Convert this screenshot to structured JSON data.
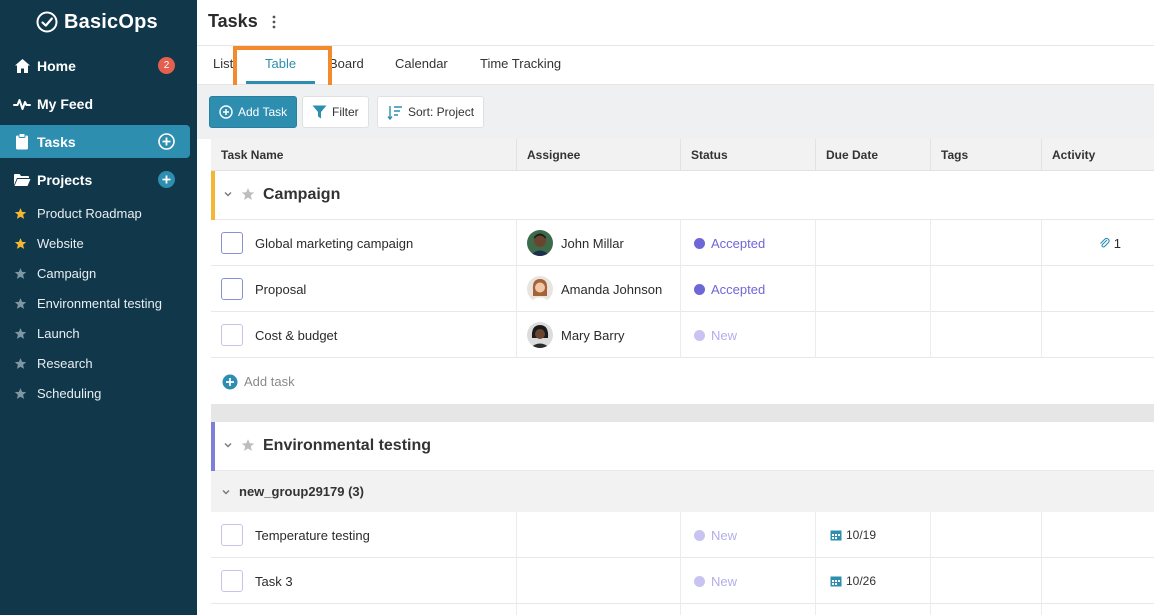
{
  "brand": {
    "name": "BasicOps"
  },
  "sidebar": {
    "nav": [
      {
        "label": "Home",
        "icon": "home-icon",
        "badge": "2"
      },
      {
        "label": "My Feed",
        "icon": "pulse-icon"
      },
      {
        "label": "Tasks",
        "icon": "clipboard-icon",
        "active": true
      },
      {
        "label": "Projects",
        "icon": "folder-icon"
      }
    ],
    "projects": [
      {
        "label": "Product Roadmap",
        "starred": true
      },
      {
        "label": "Website",
        "starred": true
      },
      {
        "label": "Campaign",
        "starred": false
      },
      {
        "label": "Environmental testing",
        "starred": false
      },
      {
        "label": "Launch",
        "starred": false
      },
      {
        "label": "Research",
        "starred": false
      },
      {
        "label": "Scheduling",
        "starred": false
      }
    ]
  },
  "header": {
    "title": "Tasks"
  },
  "tabs": [
    {
      "label": "List"
    },
    {
      "label": "Table",
      "active": true
    },
    {
      "label": "Board"
    },
    {
      "label": "Calendar"
    },
    {
      "label": "Time Tracking"
    }
  ],
  "toolbar": {
    "add_task": "Add Task",
    "filter": "Filter",
    "sort": "Sort: Project"
  },
  "columns": [
    "Task Name",
    "Assignee",
    "Status",
    "Due Date",
    "Tags",
    "Activity"
  ],
  "groups": [
    {
      "title": "Campaign",
      "color": "#f5b731",
      "tasks": [
        {
          "name": "Global marketing campaign",
          "assignee": "John Millar",
          "status": "Accepted",
          "due": "",
          "activity": "1"
        },
        {
          "name": "Proposal",
          "assignee": "Amanda Johnson",
          "status": "Accepted",
          "due": "",
          "activity": ""
        },
        {
          "name": "Cost & budget",
          "assignee": "Mary Barry",
          "status": "New",
          "due": "",
          "activity": ""
        }
      ],
      "add_task_label": "Add task"
    },
    {
      "title": "Environmental testing",
      "color": "#7d7fd8",
      "subgroup": "new_group29179 (3)",
      "tasks": [
        {
          "name": "Temperature testing",
          "assignee": "",
          "status": "New",
          "due": "10/19",
          "activity": ""
        },
        {
          "name": "Task 3",
          "assignee": "",
          "status": "New",
          "due": "10/26",
          "activity": ""
        }
      ]
    }
  ],
  "colors": {
    "sidebar_bg": "#11374a",
    "accent": "#2d8eb0",
    "status_accepted": "#6e67d6",
    "status_new": "#b9b3ee",
    "highlight": "#f28a2e"
  }
}
